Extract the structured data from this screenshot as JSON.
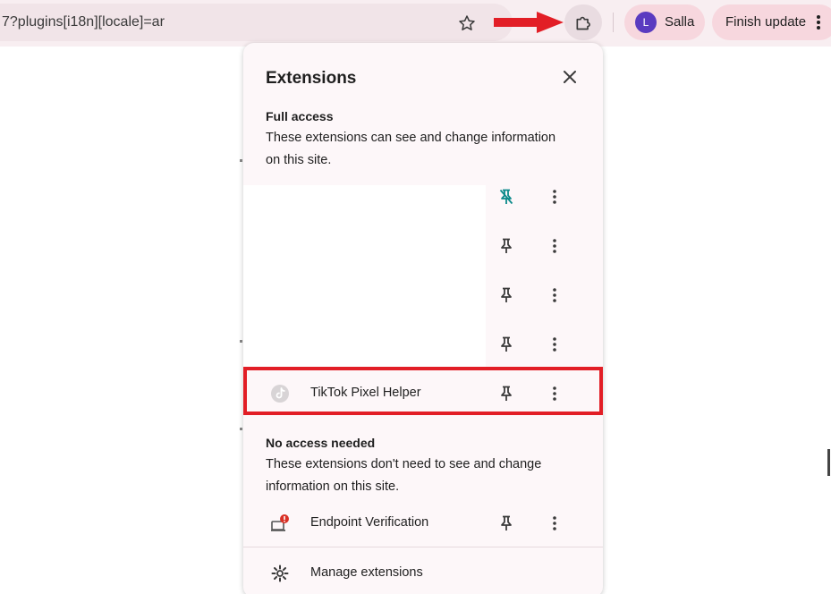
{
  "toolbar": {
    "url": "7?plugins[i18n][locale]=ar",
    "profile": {
      "initial": "L",
      "name": "Salla",
      "avatar_color": "#5a3bc0"
    },
    "update_label": "Finish update",
    "icons": [
      "star-icon",
      "puzzle-icon",
      "kebab-menu-icon"
    ]
  },
  "annotation": {
    "arrow_color": "#e21e26",
    "highlight_color": "#e21e26"
  },
  "panel": {
    "title": "Extensions",
    "full_access": {
      "title": "Full access",
      "description": "These extensions can see and change information on this site."
    },
    "full_access_items": [
      {
        "name": "",
        "pinned": true
      },
      {
        "name": "",
        "pinned": false
      },
      {
        "name": "",
        "pinned": false
      },
      {
        "name": "",
        "pinned": false
      },
      {
        "name": "TikTok Pixel Helper",
        "pinned": false
      }
    ],
    "no_access": {
      "title": "No access needed",
      "description": "These extensions don't need to see and change information on this site."
    },
    "no_access_items": [
      {
        "name": "Endpoint Verification",
        "pinned": false
      }
    ],
    "manage_label": "Manage extensions"
  }
}
